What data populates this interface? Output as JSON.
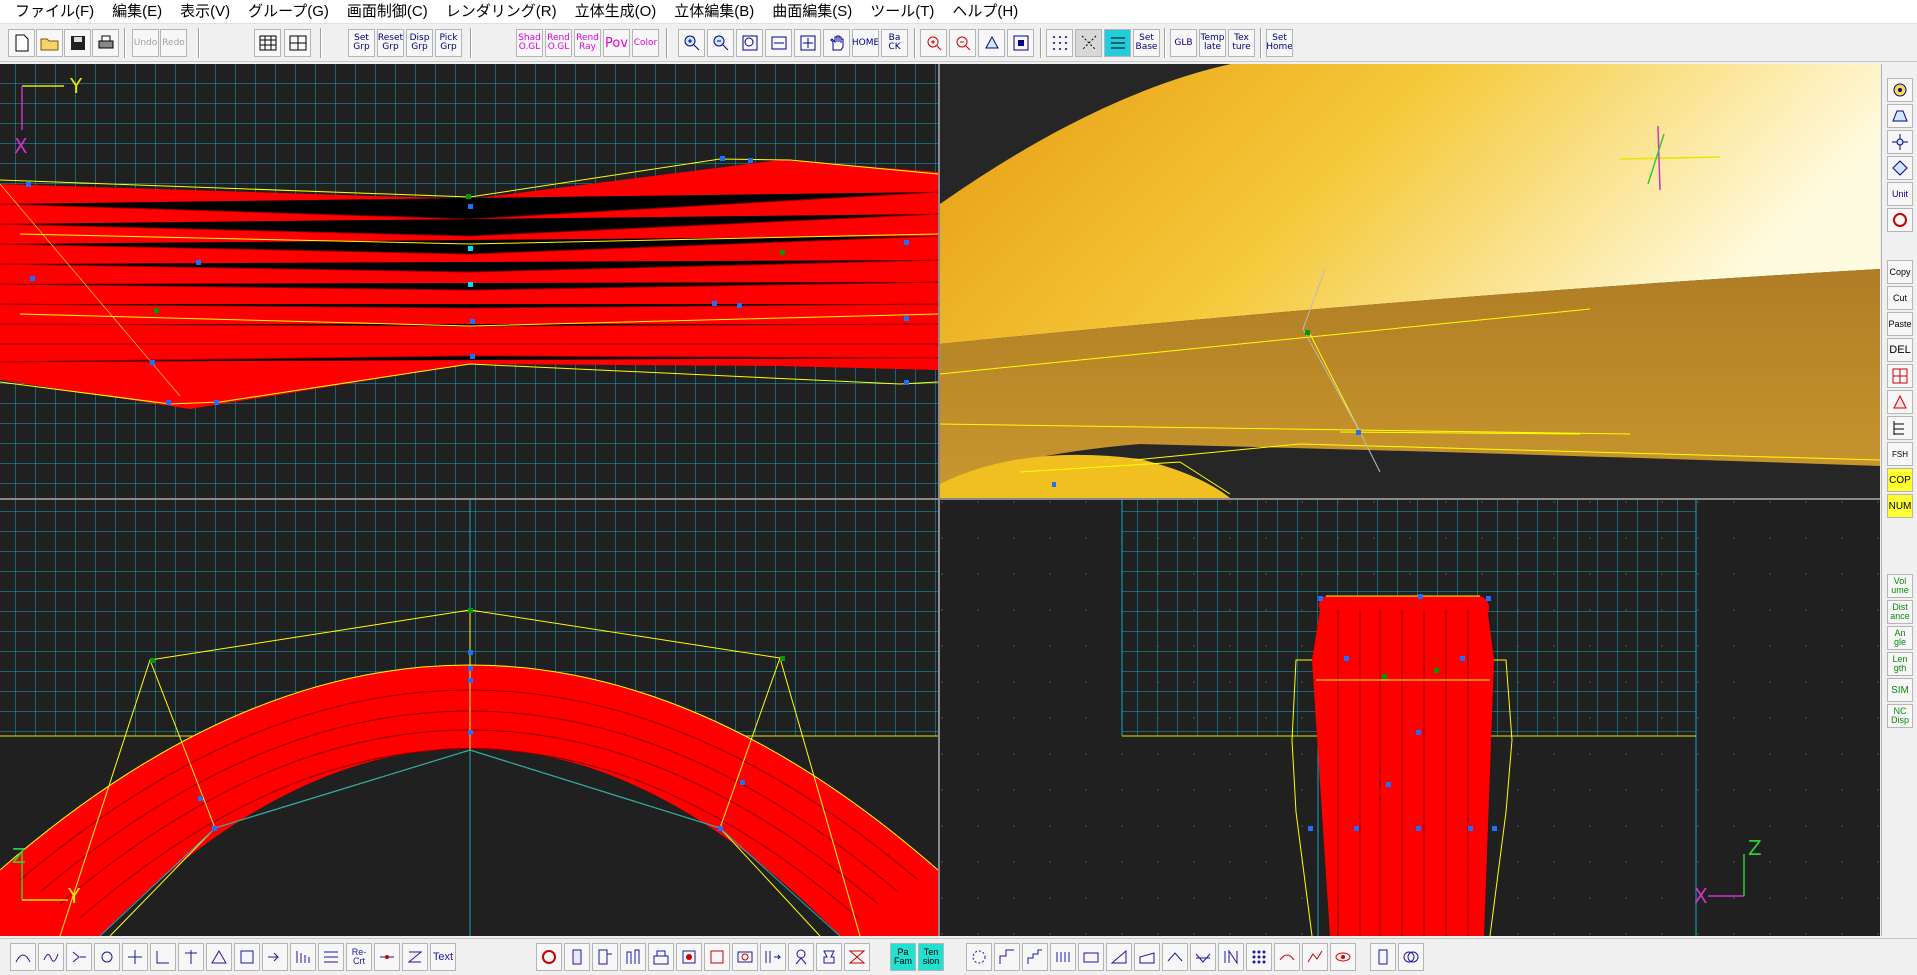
{
  "menu": [
    {
      "id": "file",
      "label": "ファイル(F)"
    },
    {
      "id": "edit",
      "label": "編集(E)"
    },
    {
      "id": "view",
      "label": "表示(V)"
    },
    {
      "id": "group",
      "label": "グループ(G)"
    },
    {
      "id": "screen",
      "label": "画面制御(C)"
    },
    {
      "id": "render",
      "label": "レンダリング(R)"
    },
    {
      "id": "solid-gen",
      "label": "立体生成(O)"
    },
    {
      "id": "solid-edit",
      "label": "立体編集(B)"
    },
    {
      "id": "surface-edit",
      "label": "曲面編集(S)"
    },
    {
      "id": "tool",
      "label": "ツール(T)"
    },
    {
      "id": "help",
      "label": "ヘルプ(H)"
    }
  ],
  "toolbar": {
    "undo": "Undo",
    "redo": "Redo",
    "set_grp": "Set Grp",
    "reset_grp": "Reset Grp",
    "disp_grp": "Disp Grp",
    "pick_grp": "Pick Grp",
    "shad_ogl": "Shad O.GL",
    "rend_ogl": "Rend O.GL",
    "rend_ray": "Rend Ray",
    "pov": "Pov",
    "color": "Color",
    "home": "HOME",
    "back": "Ba CK",
    "set_base": "Set Base",
    "glb": "GLB",
    "template": "Temp late",
    "texture": "Tex ture",
    "set_home": "Set Home"
  },
  "right_toolbar": {
    "unit": "Unit",
    "copy": "Copy",
    "cut": "Cut",
    "paste": "Paste",
    "del": "DEL",
    "fsh": "FSH",
    "cop": "COP",
    "num": "NUM",
    "volume": "Vol ume",
    "distance": "Dist ance",
    "angle": "An gle",
    "length": "Len gth",
    "sim": "SIM",
    "nc_disp": "NC Disp"
  },
  "bottom_toolbar": {
    "re_crt": "Re- Crt",
    "text": "Text",
    "pa_fam": "Pa Fam",
    "ten_sion": "Ten sion"
  },
  "axes": {
    "top_left": {
      "h": "Y",
      "v": "X"
    },
    "bottom_left": {
      "h": "Y",
      "v": "Z"
    },
    "bottom_right": {
      "h": "X",
      "v": "Z"
    }
  },
  "colors": {
    "grid": "#17a7c0",
    "mesh": "#ff0000",
    "wire": "#ffff00",
    "axis_h": "#e6e600",
    "axis_v": "#cc33cc",
    "axis_green": "#33cc33",
    "render_gold": "#c8962e"
  }
}
